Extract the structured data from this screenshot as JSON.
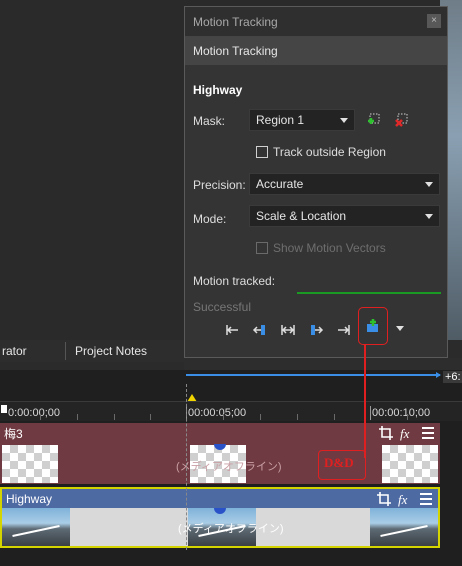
{
  "panel": {
    "window_title": "Motion Tracking",
    "close_glyph": "×",
    "header": "Motion Tracking",
    "section_title": "Highway",
    "mask_label": "Mask:",
    "mask_value": "Region 1",
    "track_outside_label": "Track outside Region",
    "precision_label": "Precision:",
    "precision_value": "Accurate",
    "mode_label": "Mode:",
    "mode_value": "Scale & Location",
    "show_vectors_label": "Show Motion Vectors",
    "motion_tracked_label": "Motion tracked:",
    "progress": 1.0,
    "status": "Successful",
    "icons": [
      "add-region-icon",
      "remove-region-icon",
      "track-backward-start-icon",
      "track-backward-icon",
      "track-both-icon",
      "track-forward-icon",
      "track-forward-end-icon",
      "apply-motion-icon",
      "dropdown-caret-icon"
    ]
  },
  "tabs": [
    "rator",
    "Project Notes"
  ],
  "timeline": {
    "range_label": "+6:",
    "timecodes": [
      "0:00:00;00",
      "00:00:05;00",
      "00:00:10;00"
    ],
    "tracks": [
      {
        "name": "梅3",
        "clip_label": "(メディアオフライン)",
        "color": "#6f3a41"
      },
      {
        "name": "Highway",
        "clip_label": "(メディアオフライン)",
        "color": "#4e6aa3"
      }
    ],
    "annotation": "D&D"
  },
  "colors": {
    "accent_red": "#e02020",
    "progress_green": "#1a9a22",
    "range_blue": "#3a8ee6"
  }
}
